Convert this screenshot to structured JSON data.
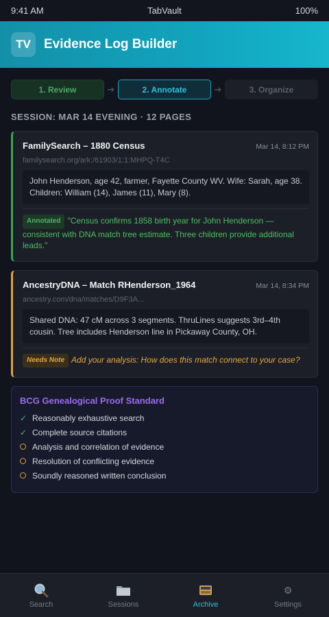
{
  "status_bar": {
    "time": "9:41 AM",
    "title": "TabVault",
    "battery": "100%"
  },
  "header": {
    "logo": "TV",
    "title": "Evidence Log Builder"
  },
  "stepper": {
    "steps": [
      {
        "label": "1. Review",
        "state": "done"
      },
      {
        "label": "2. Annotate",
        "state": "active"
      },
      {
        "label": "3. Organize",
        "state": "todo"
      }
    ]
  },
  "session": {
    "title": "SESSION: MAR 14 EVENING · 12 PAGES"
  },
  "cards": [
    {
      "title": "FamilySearch – 1880 Census",
      "time": "Mar 14, 8:12 PM",
      "url": "familysearch.org/ark:/61903/1:1:MHPQ-T4C",
      "excerpt": "John Henderson, age 42, farmer, Fayette County WV. Wife: Sarah, age 38. Children: William (14), James (11), Mary (8).",
      "badge": "Annotated",
      "note": "\"Census confirms 1858 birth year for John Henderson — consistent with DNA match tree estimate. Three children provide additional leads.\"",
      "accent": "#36a853"
    },
    {
      "title": "AncestryDNA – Match RHenderson_1964",
      "time": "Mar 14, 8:34 PM",
      "url": "ancestry.com/dna/matches/D9F3A...",
      "excerpt": "Shared DNA: 47 cM across 3 segments. ThruLines suggests 3rd–4th cousin. Tree includes Henderson line in Pickaway County, OH.",
      "badge": "Needs Note",
      "note": "Add your analysis: How does this match connect to your case?",
      "accent": "#e4a43b"
    }
  ],
  "gps": {
    "title": "BCG Genealogical Proof Standard",
    "items": [
      {
        "label": "Reasonably exhaustive search",
        "done": true
      },
      {
        "label": "Complete source citations",
        "done": true
      },
      {
        "label": "Analysis and correlation of evidence",
        "done": false
      },
      {
        "label": "Resolution of conflicting evidence",
        "done": false
      },
      {
        "label": "Soundly reasoned written conclusion",
        "done": false
      }
    ]
  },
  "tabbar": {
    "tabs": [
      {
        "label": "Search",
        "icon": "magnifier-icon"
      },
      {
        "label": "Sessions",
        "icon": "folder-icon"
      },
      {
        "label": "Archive",
        "icon": "card-file-box-icon",
        "active": true
      },
      {
        "label": "Settings",
        "icon": "gear-icon"
      }
    ]
  }
}
